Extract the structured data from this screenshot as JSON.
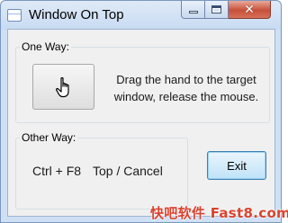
{
  "window": {
    "title": "Window On Top",
    "caption_buttons": {
      "minimize": "minimize-icon",
      "maximize": "maximize-icon",
      "close": "close-icon"
    }
  },
  "one_way": {
    "label": "One Way:",
    "button_icon": "hand-pointer-icon",
    "instructions": "Drag the hand to the target window, release the mouse."
  },
  "other_way": {
    "label": "Other Way:",
    "hotkey": "Ctrl + F8",
    "action": "Top / Cancel"
  },
  "exit_label": "Exit",
  "watermark": "快吧软件 Fast8.com",
  "colors": {
    "frame": "#cfe0f4",
    "close_button": "#c7503a",
    "exit_border": "#3c7fb1",
    "watermark": "#d9432f"
  }
}
